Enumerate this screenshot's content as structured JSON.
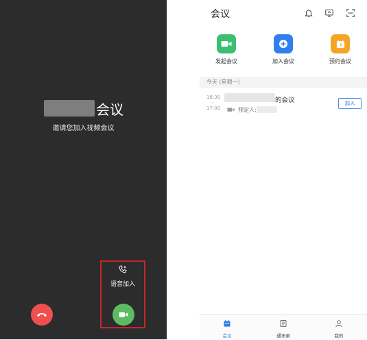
{
  "call_screen": {
    "title_suffix": "会议",
    "subtitle": "邀请您加入视频会议",
    "voice_join_label": "语音加入"
  },
  "meeting_app": {
    "title": "会议",
    "quick_actions": [
      {
        "label": "发起会议",
        "icon": "video-camera-icon",
        "color": "#3dbf72"
      },
      {
        "label": "加入会议",
        "icon": "plus-icon",
        "color": "#2f7ff0"
      },
      {
        "label": "预约会议",
        "icon": "calendar-icon",
        "color": "#f5a423"
      }
    ],
    "date_section": "今天 (星期一)",
    "meeting": {
      "start_time": "16:30",
      "separator": "-",
      "end_time": "17:00",
      "title_suffix": "的会议",
      "host_label": "预定人:",
      "join_label": "加入"
    },
    "nav": [
      {
        "label": "会议",
        "icon": "calendar-icon",
        "active": true
      },
      {
        "label": "通讯录",
        "icon": "contacts-icon",
        "active": false
      },
      {
        "label": "我的",
        "icon": "person-icon",
        "active": false
      }
    ]
  },
  "colors": {
    "accent_blue": "#2b7de1",
    "decline_red": "#ef4f4f",
    "accept_green": "#5dbb63",
    "highlight_red": "#c8262c"
  }
}
